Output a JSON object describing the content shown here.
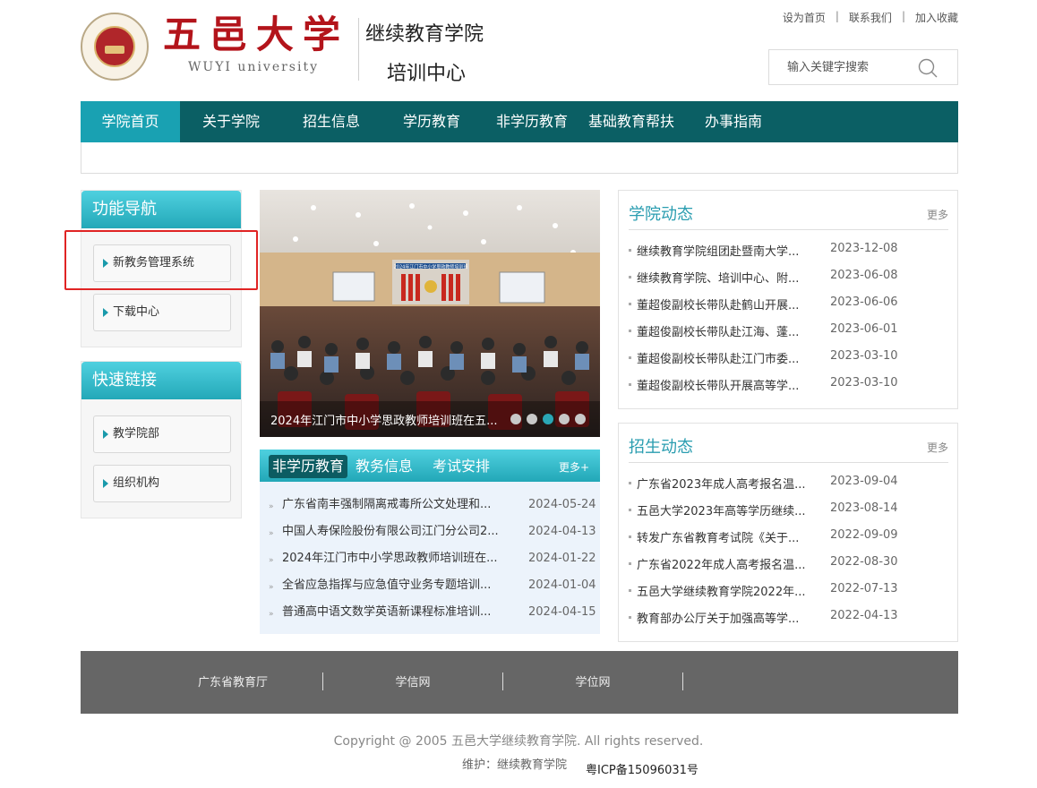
{
  "header": {
    "logo_text": "五邑大学",
    "logo_en": "WUYI university",
    "college": "继续教育学院",
    "center": "培训中心",
    "top_links": [
      "设为首页",
      "联系我们",
      "加入收藏"
    ],
    "search_placeholder": "输入关键字搜索"
  },
  "nav": [
    "学院首页",
    "关于学院",
    "招生信息",
    "学历教育",
    "非学历教育",
    "基础教育帮扶",
    "办事指南"
  ],
  "sidebar": {
    "func_title": "功能导航",
    "func_items": [
      "新教务管理系统",
      "下载中心"
    ],
    "quick_title": "快速链接",
    "quick_items": [
      "教学院部",
      "组织机构"
    ]
  },
  "slider": {
    "caption": "2024年江门市中小学思政教师培训班在五...",
    "banner": "2024年江门市中小学思政教师培训班",
    "dots": 5,
    "active_dot": 3
  },
  "tabs": {
    "labels": [
      "非学历教育",
      "教务信息",
      "考试安排"
    ],
    "more": "更多+",
    "items": [
      {
        "title": "广东省南丰强制隔离戒毒所公文处理和...",
        "date": "2024-05-24"
      },
      {
        "title": "中国人寿保险股份有限公司江门分公司2...",
        "date": "2024-04-13"
      },
      {
        "title": "2024年江门市中小学思政教师培训班在...",
        "date": "2024-01-22"
      },
      {
        "title": "全省应急指挥与应急值守业务专题培训...",
        "date": "2024-01-04"
      },
      {
        "title": "普通高中语文数学英语新课程标准培训...",
        "date": "2024-04-15"
      }
    ]
  },
  "college_news": {
    "title": "学院动态",
    "more": "更多",
    "items": [
      {
        "title": "继续教育学院组团赴暨南大学...",
        "date": "2023-12-08"
      },
      {
        "title": "继续教育学院、培训中心、附...",
        "date": "2023-06-08"
      },
      {
        "title": "董超俊副校长带队赴鹤山开展...",
        "date": "2023-06-06"
      },
      {
        "title": "董超俊副校长带队赴江海、蓬...",
        "date": "2023-06-01"
      },
      {
        "title": "董超俊副校长带队赴江门市委...",
        "date": "2023-03-10"
      },
      {
        "title": "董超俊副校长带队开展高等学...",
        "date": "2023-03-10"
      }
    ]
  },
  "enroll_news": {
    "title": "招生动态",
    "more": "更多",
    "items": [
      {
        "title": "广东省2023年成人高考报名温...",
        "date": "2023-09-04"
      },
      {
        "title": "五邑大学2023年高等学历继续...",
        "date": "2023-08-14"
      },
      {
        "title": "转发广东省教育考试院《关于...",
        "date": "2022-09-09"
      },
      {
        "title": "广东省2022年成人高考报名温...",
        "date": "2022-08-30"
      },
      {
        "title": "五邑大学继续教育学院2022年...",
        "date": "2022-07-13"
      },
      {
        "title": "教育部办公厅关于加强高等学...",
        "date": "2022-04-13"
      }
    ]
  },
  "footer": {
    "links": [
      "广东省教育厅",
      "学信网",
      "学位网"
    ],
    "copyright": "Copyright @ 2005 五邑大学继续教育学院. All rights reserved.",
    "maintainer": "维护：继续教育学院",
    "icp": "粤ICP备15096031号"
  }
}
